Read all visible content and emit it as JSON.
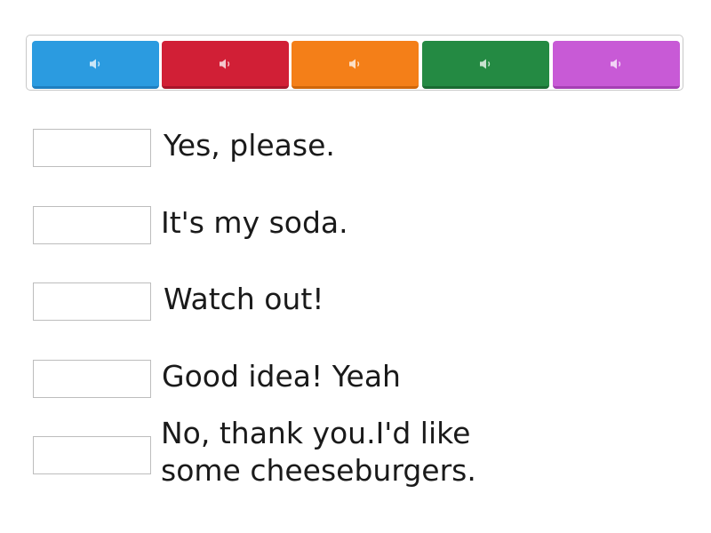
{
  "tiles": [
    {
      "color": "#2b9be0",
      "border": "#1f7fc0",
      "icon": "speaker-icon"
    },
    {
      "color": "#d11f36",
      "border": "#a8152a",
      "icon": "speaker-icon"
    },
    {
      "color": "#f47f18",
      "border": "#cf6609",
      "icon": "speaker-icon"
    },
    {
      "color": "#248a43",
      "border": "#196a32",
      "icon": "speaker-icon"
    },
    {
      "color": "#c85ad6",
      "border": "#a53fb4",
      "icon": "speaker-icon"
    }
  ],
  "prompts": [
    {
      "text": "Yes, please."
    },
    {
      "text": "It's my soda."
    },
    {
      "text": "Watch out!"
    },
    {
      "text": "Good idea! Yeah"
    },
    {
      "text": "No, thank you.I'd like\nsome cheeseburgers."
    }
  ]
}
